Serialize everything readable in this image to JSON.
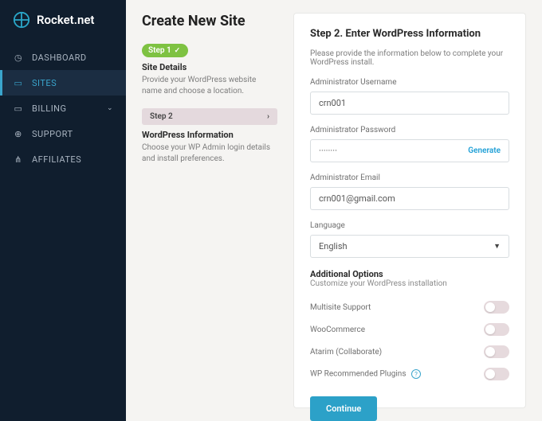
{
  "brand": {
    "name": "Rocket.net"
  },
  "nav": {
    "dashboard": "DASHBOARD",
    "sites": "SITES",
    "billing": "BILLING",
    "support": "SUPPORT",
    "affiliates": "AFFILIATES"
  },
  "page": {
    "title": "Create New Site"
  },
  "step1": {
    "pill": "Step 1",
    "heading": "Site Details",
    "desc": "Provide your WordPress website name and choose a location."
  },
  "step2": {
    "tabLabel": "Step 2",
    "heading": "WordPress Information",
    "desc": "Choose your WP Admin login details and install preferences."
  },
  "panel": {
    "title": "Step 2. Enter WordPress Information",
    "hint": "Please provide the information below to complete your WordPress install.",
    "usernameLabel": "Administrator Username",
    "usernameValue": "crn001",
    "passwordLabel": "Administrator Password",
    "passwordValue": "········",
    "generate": "Generate",
    "emailLabel": "Administrator Email",
    "emailValue": "crn001@gmail.com",
    "languageLabel": "Language",
    "languageValue": "English",
    "optionsTitle": "Additional Options",
    "optionsSub": "Customize your WordPress installation",
    "options": {
      "multisite": "Multisite Support",
      "woo": "WooCommerce",
      "atarim": "Atarim (Collaborate)",
      "plugins": "WP Recommended Plugins"
    },
    "continue": "Continue"
  }
}
